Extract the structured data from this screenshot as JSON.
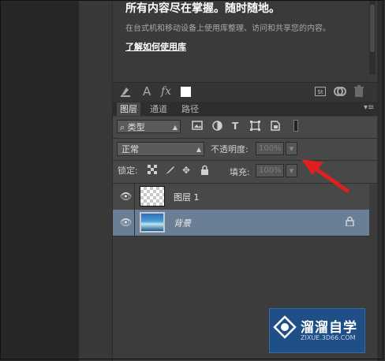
{
  "library": {
    "title": "所有内容尽在掌握。随时随地。",
    "description": "在台式机和移动设备上使用库整理、访问和共享您的内容。",
    "link": "了解如何使用库"
  },
  "library_toolbar": {
    "icons": [
      "stamp-icon",
      "text-A-icon",
      "fx-icon",
      "color-swatch",
      "stock-icon",
      "cc-icon",
      "trash-icon"
    ],
    "text_a": "A",
    "fx": "fx",
    "stock": "St"
  },
  "tabs": [
    {
      "label": "图层",
      "active": true
    },
    {
      "label": "通道",
      "active": false
    },
    {
      "label": "路径",
      "active": false
    }
  ],
  "filter": {
    "selected": "类型",
    "icons": [
      "image-filter-icon",
      "adjustment-filter-icon",
      "type-filter-icon",
      "shape-filter-icon",
      "smart-object-filter-icon",
      "filter-toggle"
    ]
  },
  "blend": {
    "mode": "正常",
    "opacity_label": "不透明度:",
    "opacity_value": "100%"
  },
  "lock": {
    "label": "锁定:",
    "fill_label": "填充:",
    "fill_value": "100%"
  },
  "layers": [
    {
      "name": "图层 1",
      "selected": false,
      "locked": false,
      "thumbnail": "transparent"
    },
    {
      "name": "背景",
      "selected": true,
      "locked": true,
      "thumbnail": "landscape"
    }
  ],
  "colors": {
    "panel": "#484848",
    "selected_layer": "#6a7f96",
    "annotation_arrow": "#e02020",
    "watermark": "#1f4f86"
  },
  "watermark": {
    "title": "溜溜自学",
    "url": "ZIXUE.3D66.COM"
  }
}
